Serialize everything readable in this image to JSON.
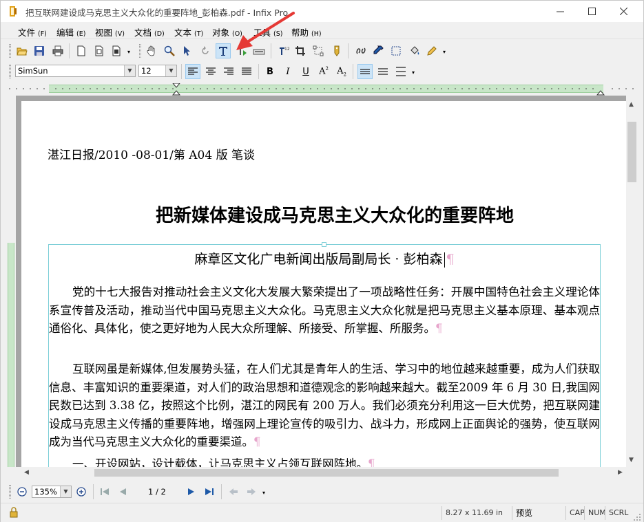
{
  "window": {
    "title": "把互联网建设成马克思主义大众化的重要阵地_彭柏森.pdf - Infix Pro"
  },
  "menu": [
    {
      "label": "文件",
      "key": "(F)"
    },
    {
      "label": "编辑",
      "key": "(E)"
    },
    {
      "label": "视图",
      "key": "(V)"
    },
    {
      "label": "文档",
      "key": "(D)"
    },
    {
      "label": "文本",
      "key": "(T)"
    },
    {
      "label": "对象",
      "key": "(O)"
    },
    {
      "label": "工具",
      "key": "(S)"
    },
    {
      "label": "帮助",
      "key": "(H)"
    }
  ],
  "format_bar": {
    "font": "SimSun",
    "size": "12"
  },
  "document": {
    "header": "湛江日报/2010 -08-01/第 A04 版 笔谈",
    "title": "把新媒体建设成马克思主义大众化的重要阵地",
    "byline": "麻章区文化广电新闻出版局副局长 · 彭柏森",
    "paragraphs": [
      "党的十七大报告对推动社会主义文化大发展大繁荣提出了一项战略性任务：开展中国特色社会主义理论体系宣传普及活动，推动当代中国马克思主义大众化。马克思主义大众化就是把马克思主义基本原理、基本观点通俗化、具体化，使之更好地为人民大众所理解、所接受、所掌握、所服务。",
      "互联网虽是新媒体,但发展势头猛，在人们尤其是青年人的生活、学习中的地位越来越重要，成为人们获取信息、丰富知识的重要渠道，对人们的政治思想和道德观念的影响越来越大。截至2009 年 6 月 30 日,我国网民数已达到 3.38 亿，按照这个比例，湛江的网民有 200 万人。我们必须充分利用这一巨大优势，把互联网建设成马克思主义传播的重要阵地，增强网上理论宣传的吸引力、战斗力，形成网上正面舆论的强势，使互联网成为当代马克思主义大众化的重要渠道。",
      "一、开设网站，设计载体，让马克思主义占领互联网阵地。"
    ]
  },
  "nav": {
    "zoom": "135%",
    "page": "1 / 2"
  },
  "status": {
    "page_size": "8.27 x 11.69 in",
    "mode": "预览",
    "caps": "CAP",
    "num": "NUM",
    "scrl": "SCRL"
  },
  "colors": {
    "accent": "#cce4f7",
    "margin_green": "#c8e6c8",
    "frame": "#7ecfd8",
    "annotation": "#e53935"
  }
}
